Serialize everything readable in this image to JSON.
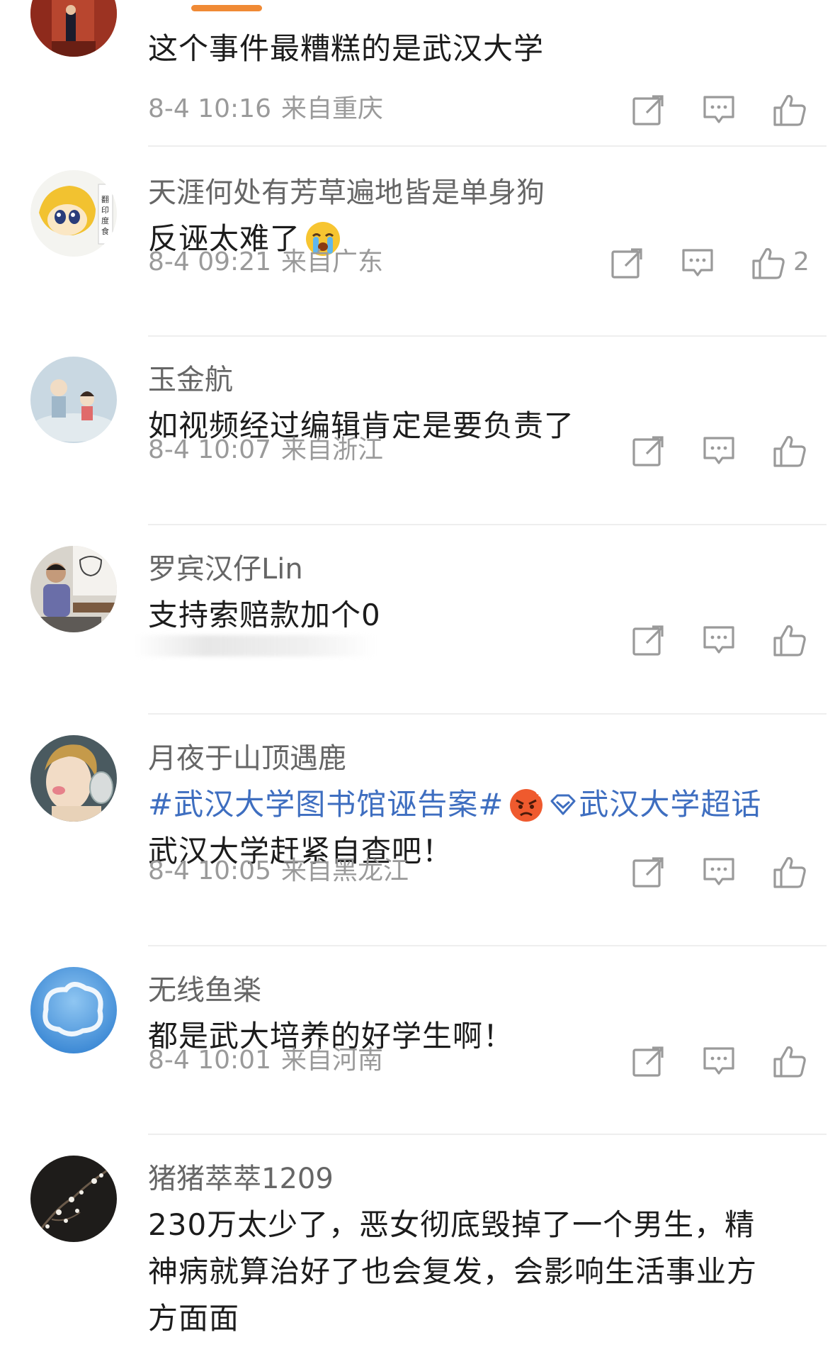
{
  "colors": {
    "topic_link": "#3e6ec0",
    "scroll_indicator": "#f08a35",
    "meta_text": "#9a9a9a",
    "username_text": "#666666"
  },
  "icons": {
    "share": "share-icon",
    "comment": "comment-icon",
    "like": "thumbs-up-icon",
    "emoji_crying": "crying-face-icon",
    "emoji_angry": "angry-face-icon",
    "super_topic": "diamond-icon"
  },
  "comments": [
    {
      "username": "",
      "text": "这个事件最糟糕的是武汉大学",
      "date": "8-4 10:16",
      "location": "来自重庆",
      "likes": ""
    },
    {
      "username": "天涯何处有芳草遍地皆是单身狗",
      "text": "反诬太难了",
      "date": "8-4 09:21",
      "location": "来自广东",
      "likes": "2"
    },
    {
      "username": "玉金航",
      "text": "如视频经过编辑肯定是要负责了",
      "date": "8-4 10:07",
      "location": "来自浙江",
      "likes": ""
    },
    {
      "username": "罗宾汉仔Lin",
      "text": "支持索赔款加个0",
      "date": "",
      "location": "",
      "likes": ""
    },
    {
      "username": "月夜于山顶遇鹿",
      "topic": "#武汉大学图书馆诬告案#",
      "super_topic": "武汉大学超话",
      "text": "武汉大学赶紧自查吧！",
      "date": "8-4 10:05",
      "location": "来自黑龙江",
      "likes": ""
    },
    {
      "username": "无线鱼楽",
      "text": "都是武大培养的好学生啊！",
      "date": "8-4 10:01",
      "location": "来自河南",
      "likes": ""
    },
    {
      "username": "猪猪萃萃1209",
      "text_lines": [
        "230万太少了，恶女彻底毁掉了一个男生，精",
        "神病就算治好了也会复发，会影响生活事业方",
        "方面面"
      ],
      "date": "",
      "location": "",
      "likes": ""
    }
  ]
}
